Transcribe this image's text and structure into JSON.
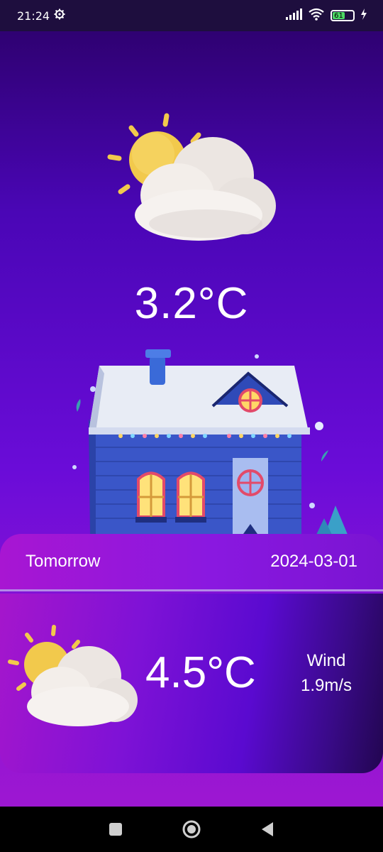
{
  "status_bar": {
    "time": "21:24",
    "battery_level": "61",
    "icons": [
      "gear-icon",
      "signal-icon",
      "wifi-icon",
      "battery-icon",
      "charging-icon"
    ]
  },
  "current": {
    "temperature": "3.2°C",
    "icon": "partly-cloudy-icon"
  },
  "forecast": {
    "label": "Tomorrow",
    "date": "2024-03-01",
    "temperature": "4.5°C",
    "wind_label": "Wind",
    "wind_value": "1.9m/s",
    "icon": "partly-cloudy-icon"
  },
  "nav": {
    "buttons": [
      "recents-square-icon",
      "home-circle-icon",
      "back-triangle-icon"
    ]
  },
  "colors": {
    "background_top": "#2a0066",
    "background_bottom": "#a218d0",
    "sun": "#f2c94c",
    "cloud": "#f3f0ee"
  }
}
